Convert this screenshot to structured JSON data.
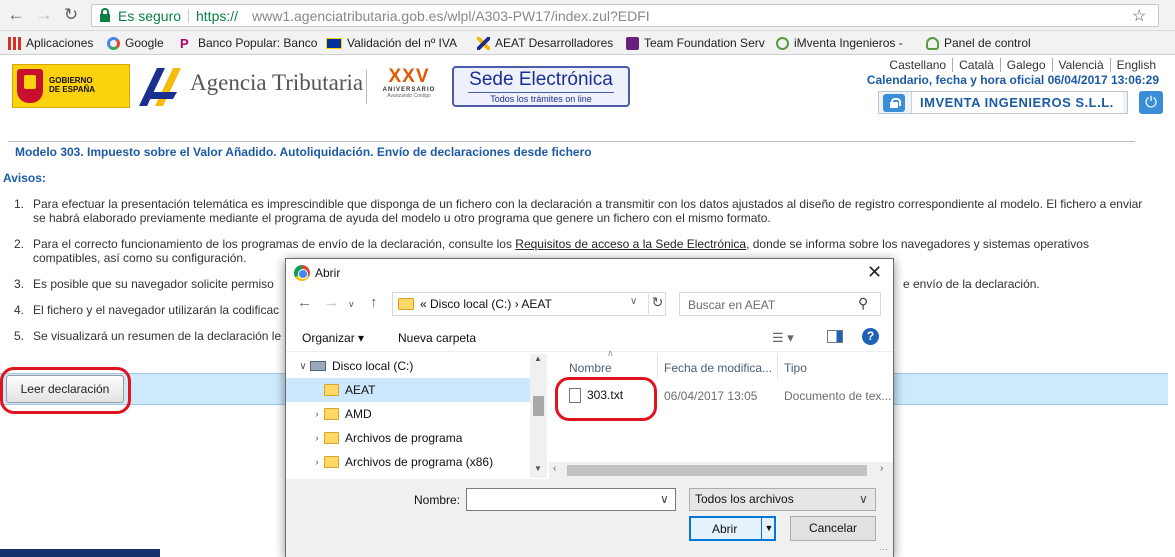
{
  "browser": {
    "secure_label": "Es seguro",
    "url_protocol": "https://",
    "url_rest": "www1.agenciatributaria.gob.es/wlpl/A303-PW17/index.zul?EDFI",
    "bookmarks": [
      {
        "label": "Aplicaciones",
        "icon": "apps-grid-icon"
      },
      {
        "label": "Google",
        "icon": "google-icon"
      },
      {
        "label": "Banco Popular: Banco",
        "icon": "banco-popular-icon"
      },
      {
        "label": "Validación del nº IVA",
        "icon": "eu-flag-icon"
      },
      {
        "label": "AEAT Desarrolladores",
        "icon": "aeat-icon"
      },
      {
        "label": "Team Foundation Serv",
        "icon": "visual-studio-icon"
      },
      {
        "label": "iMventa Ingenieros -",
        "icon": "imventa-icon"
      },
      {
        "label": "Panel de control",
        "icon": "panel-icon"
      }
    ]
  },
  "header": {
    "gobierno_line1": "GOBIERNO",
    "gobierno_line2": "DE ESPAÑA",
    "agency_name": "Agencia Tributaria",
    "anniversary_numeral": "XXV",
    "anniversary_word": "ANIVERSARIO",
    "anniversary_motto": "Avanzando Contigo",
    "sede_title": "Sede Electrónica",
    "sede_subtitle": "Todos los trámites on line",
    "languages": [
      "Castellano",
      "Català",
      "Galego",
      "Valencià",
      "English"
    ],
    "calendar": "Calendario, fecha y hora oficial 06/04/2017 13:06:29",
    "user": "IMVENTA INGENIEROS S.L.L."
  },
  "page": {
    "title": "Modelo 303. Impuesto sobre el Valor Añadido. Autoliquidación. Envío de declaraciones desde fichero",
    "avisos_heading": "Avisos:",
    "items": [
      {
        "num": "1.",
        "text": "Para efectuar la presentación telemática es imprescindible que disponga de un fichero con la declaración a transmitir con los datos ajustados al diseño de registro correspondiente al modelo. El fichero a enviar se habrá elaborado previamente mediante el programa de ayuda del modelo u otro programa que genere un fichero con el mismo formato."
      },
      {
        "num": "2.",
        "text_before": "Para el correcto funcionamiento de los programas de envío de la declaración, consulte los ",
        "link": "Requisitos de acceso a la Sede Electrónica",
        "text_after": ", donde se informa sobre los navegadores y sistemas operativos compatibles, así como su configuración."
      },
      {
        "num": "3.",
        "text_left": "Es posible que su navegador solicite permiso",
        "text_right": "e envío de la declaración."
      },
      {
        "num": "4.",
        "text": "El fichero y el navegador utilizarán la codificac"
      },
      {
        "num": "5.",
        "text": "Se visualizará un resumen de la declaración le"
      }
    ],
    "leer_button": "Leer declaración"
  },
  "dialog": {
    "title": "Abrir",
    "path": "«  Disco local (C:)  ›  AEAT",
    "search_placeholder": "Buscar en AEAT",
    "organizar": "Organizar",
    "nueva_carpeta": "Nueva carpeta",
    "tree": [
      {
        "label": "Disco local (C:)",
        "type": "drive",
        "expanded": true
      },
      {
        "label": "AEAT",
        "type": "folder",
        "selected": true
      },
      {
        "label": "AMD",
        "type": "folder"
      },
      {
        "label": "Archivos de programa",
        "type": "folder"
      },
      {
        "label": "Archivos de programa (x86)",
        "type": "folder"
      }
    ],
    "columns": [
      "Nombre",
      "Fecha de modifica...",
      "Tipo"
    ],
    "files": [
      {
        "name": "303.txt",
        "date": "06/04/2017 13:05",
        "type": "Documento de tex..."
      }
    ],
    "nombre_label": "Nombre:",
    "nombre_value": "",
    "filter": "Todos los archivos",
    "abrir_button": "Abrir",
    "cancelar_button": "Cancelar"
  },
  "colors": {
    "accent_blue": "#1c5aa6",
    "highlight_red": "#e0141e",
    "secure_green": "#0b8043",
    "windows_blue": "#0078d7"
  }
}
